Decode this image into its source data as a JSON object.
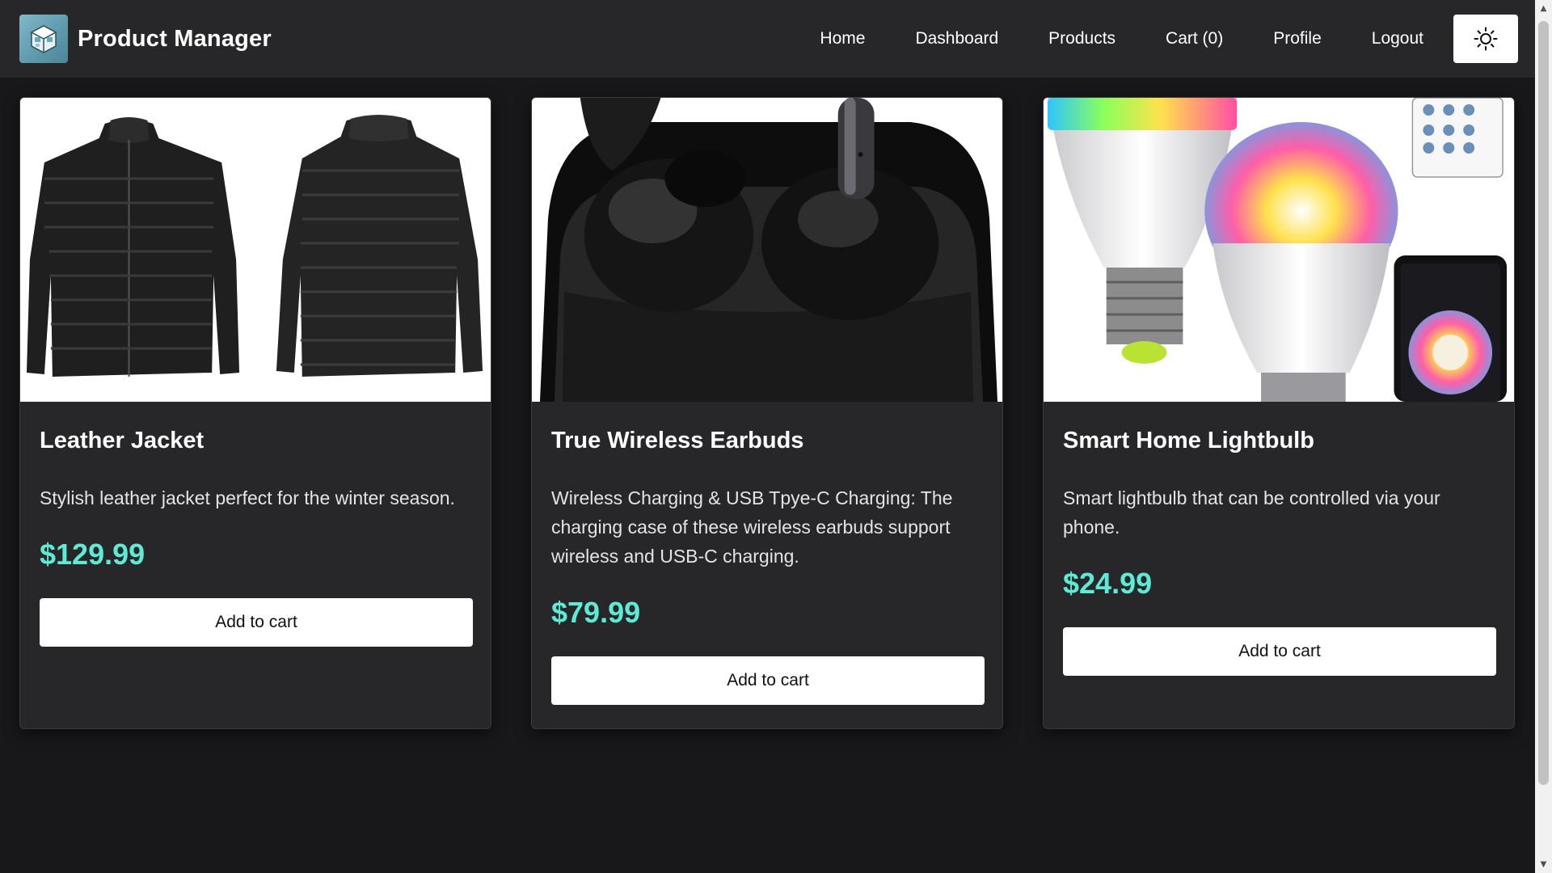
{
  "navbar": {
    "title": "Product Manager",
    "logo_icon": "cube-box-icon",
    "links": [
      "Home",
      "Dashboard",
      "Products",
      "Cart (0)",
      "Profile",
      "Logout"
    ],
    "theme_icon": "sun-icon"
  },
  "products": [
    {
      "name": "Leather Jacket",
      "description": "Stylish leather jacket perfect for the winter season.",
      "price": "$129.99",
      "button": "Add to cart"
    },
    {
      "name": "True Wireless Earbuds",
      "description": "Wireless Charging & USB Tpye-C Charging: The charging case of these wireless earbuds support wireless and USB-C charging.",
      "price": "$79.99",
      "button": "Add to cart"
    },
    {
      "name": "Smart Home Lightbulb",
      "description": "Smart lightbulb that can be controlled via your phone.",
      "price": "$24.99",
      "button": "Add to cart"
    }
  ],
  "colors": {
    "background": "#18181b",
    "surface": "#27272a",
    "price_accent": "#5eead4",
    "button_bg": "#ffffff"
  }
}
